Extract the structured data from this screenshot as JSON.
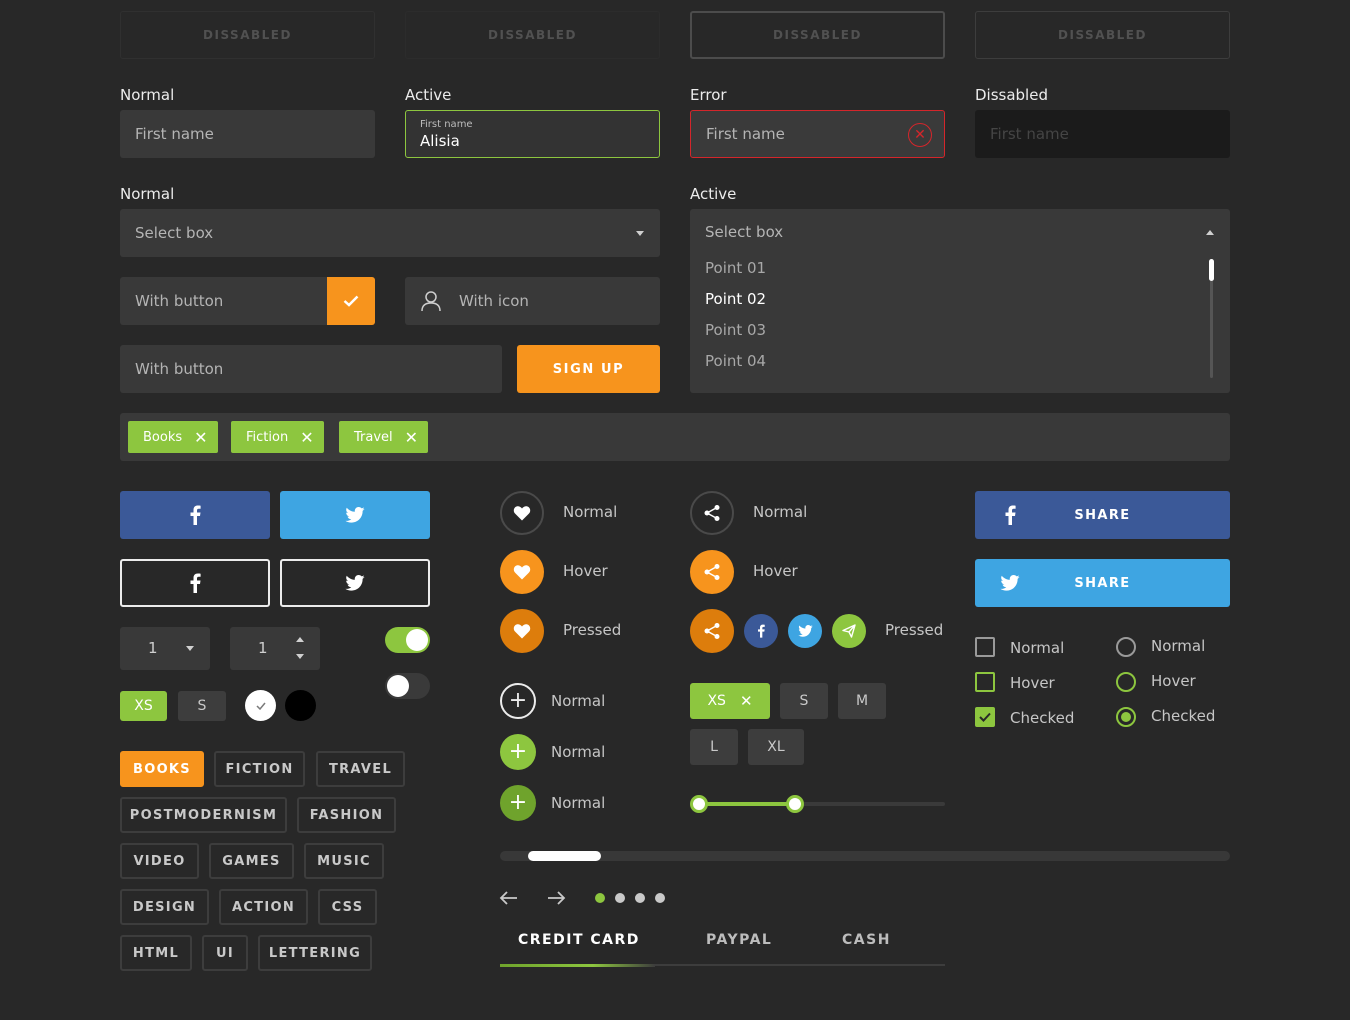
{
  "disabled_buttons": [
    "DISSABLED",
    "DISSABLED",
    "DISSABLED",
    "DISSABLED"
  ],
  "inputs": {
    "normal": {
      "label": "Normal",
      "placeholder": "First name"
    },
    "active": {
      "label": "Active",
      "small_label": "First name",
      "value": "Alisia"
    },
    "error": {
      "label": "Error",
      "placeholder": "First name"
    },
    "disabled": {
      "label": "Dissabled",
      "placeholder": "First name"
    }
  },
  "select_normal": {
    "label": "Normal",
    "value": "Select box"
  },
  "select_active": {
    "label": "Active",
    "value": "Select box",
    "options": [
      "Point 01",
      "Point 02",
      "Point 03",
      "Point 04"
    ],
    "selected": "Point 02"
  },
  "with_button": {
    "label": "With button"
  },
  "with_icon": {
    "label": "With icon"
  },
  "with_button2": {
    "label": "With button",
    "cta": "SIGN UP"
  },
  "tags_input": [
    "Books",
    "Fiction",
    "Travel"
  ],
  "share_buttons": {
    "facebook": "SHARE",
    "twitter": "SHARE"
  },
  "spinners": {
    "select_value": "1",
    "stepper_value": "1"
  },
  "toggles": {
    "first": true,
    "second": false
  },
  "sizes_small": {
    "xs": "XS",
    "s": "S"
  },
  "color_swatches": [
    "white-selected",
    "black"
  ],
  "category_tags": {
    "rows": [
      [
        "BOOKS",
        "FICTION",
        "TRAVEL"
      ],
      [
        "POSTMODERNISM",
        "FASHION"
      ],
      [
        "VIDEO",
        "GAMES",
        "MUSIC"
      ],
      [
        "DESIGN",
        "ACTION",
        "CSS"
      ],
      [
        "HTML",
        "UI",
        "LETTERING"
      ]
    ],
    "active": "BOOKS"
  },
  "like_states": [
    "Normal",
    "Hover",
    "Pressed"
  ],
  "share_states": [
    "Normal",
    "Hover",
    "Pressed"
  ],
  "add_states": [
    "Normal",
    "Normal",
    "Normal"
  ],
  "sizes_large": {
    "selected": "XS",
    "options": [
      "S",
      "M",
      "L",
      "XL"
    ]
  },
  "range": {
    "low": 0,
    "high": 0.39
  },
  "scroll": {
    "position": 0.02,
    "thumb_fraction": 0.1
  },
  "carousel": {
    "pages": 4,
    "active_page": 1
  },
  "tabs": {
    "items": [
      "CREDIT CARD",
      "PAYPAL",
      "CASH"
    ],
    "active": "CREDIT CARD"
  },
  "checkboxes": [
    "Normal",
    "Hover",
    "Checked"
  ],
  "radios": [
    "Normal",
    "Hover",
    "Checked"
  ],
  "colors": {
    "bg": "#282828",
    "green": "#8dc63f",
    "orange": "#f7941d",
    "red": "#d4262b",
    "facebook": "#3b5998",
    "twitter": "#3ea5e2"
  }
}
